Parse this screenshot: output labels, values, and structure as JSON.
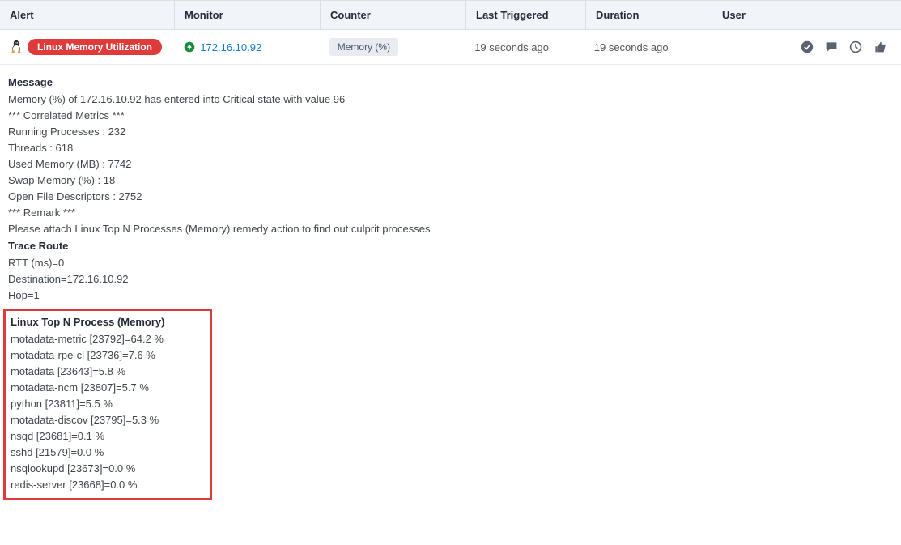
{
  "headers": {
    "alert": "Alert",
    "monitor": "Monitor",
    "counter": "Counter",
    "last": "Last Triggered",
    "duration": "Duration",
    "user": "User"
  },
  "row": {
    "alert_label": "Linux Memory Utilization",
    "monitor_ip": "172.16.10.92",
    "counter_label": "Memory (%)",
    "last_triggered": "19 seconds ago",
    "duration": "19 seconds ago",
    "user": ""
  },
  "detail": {
    "message_title": "Message",
    "message_main": "Memory (%) of 172.16.10.92 has entered into Critical state with value 96",
    "corr_header": "*** Correlated Metrics ***",
    "running_processes": "Running Processes : 232",
    "threads": "Threads : 618",
    "used_memory": "Used Memory (MB) : 7742",
    "swap": "Swap Memory (%) : 18",
    "open_fd": "Open File Descriptors : 2752",
    "remark_header": "*** Remark ***",
    "remark_text": "Please attach Linux Top N Processes (Memory) remedy action to find out culprit processes",
    "trace_title": "Trace Route",
    "rtt": "RTT (ms)=0",
    "destination": "Destination=172.16.10.92",
    "hop": "Hop=1",
    "topn_title": "Linux Top N Process (Memory)",
    "p0": "motadata-metric [23792]=64.2 %",
    "p1": "motadata-rpe-cl [23736]=7.6 %",
    "p2": "motadata [23643]=5.8 %",
    "p3": "motadata-ncm [23807]=5.7 %",
    "p4": "python [23811]=5.5 %",
    "p5": "motadata-discov [23795]=5.3 %",
    "p6": "nsqd [23681]=0.1 %",
    "p7": "sshd [21579]=0.0 %",
    "p8": "nsqlookupd [23673]=0.0 %",
    "p9": "redis-server [23668]=0.0 %"
  },
  "chart_data": {
    "type": "table",
    "title": "Linux Top N Process (Memory)",
    "columns": [
      "process",
      "pid",
      "percent"
    ],
    "rows": [
      {
        "process": "motadata-metric",
        "pid": 23792,
        "percent": 64.2
      },
      {
        "process": "motadata-rpe-cl",
        "pid": 23736,
        "percent": 7.6
      },
      {
        "process": "motadata",
        "pid": 23643,
        "percent": 5.8
      },
      {
        "process": "motadata-ncm",
        "pid": 23807,
        "percent": 5.7
      },
      {
        "process": "python",
        "pid": 23811,
        "percent": 5.5
      },
      {
        "process": "motadata-discov",
        "pid": 23795,
        "percent": 5.3
      },
      {
        "process": "nsqd",
        "pid": 23681,
        "percent": 0.1
      },
      {
        "process": "sshd",
        "pid": 21579,
        "percent": 0.0
      },
      {
        "process": "nsqlookupd",
        "pid": 23673,
        "percent": 0.0
      },
      {
        "process": "redis-server",
        "pid": 23668,
        "percent": 0.0
      }
    ],
    "correlated_metrics": {
      "running_processes": 232,
      "threads": 618,
      "used_memory_mb": 7742,
      "swap_percent": 18,
      "open_file_descriptors": 2752
    },
    "trace_route": {
      "rtt_ms": 0,
      "destination": "172.16.10.92",
      "hop": 1
    },
    "alert_value": 96
  }
}
